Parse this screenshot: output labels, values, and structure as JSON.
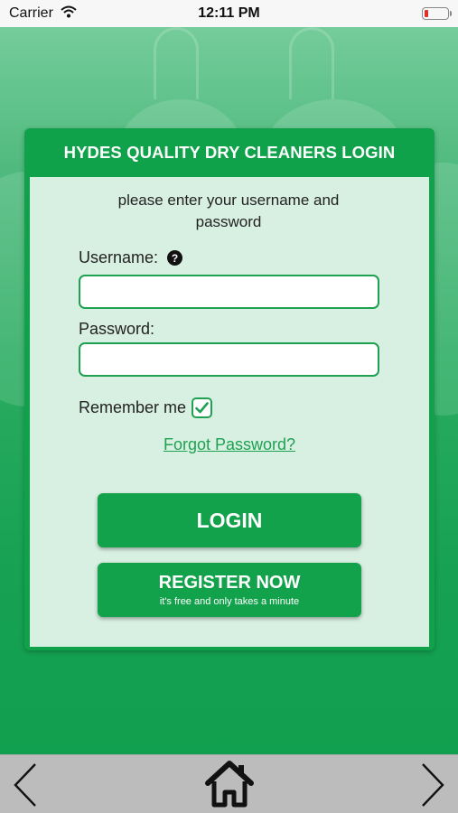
{
  "status_bar": {
    "carrier": "Carrier",
    "time": "12:11 PM"
  },
  "login": {
    "title": "HYDES QUALITY DRY CLEANERS LOGIN",
    "intro": "please enter your username and password",
    "username_label": "Username:",
    "username_value": "",
    "password_label": "Password:",
    "password_value": "",
    "remember_label": "Remember me",
    "remember_checked": true,
    "forgot_link": "Forgot Password?",
    "login_button": "LOGIN",
    "register_button": "REGISTER NOW",
    "register_subtext": "it's free and only takes a minute"
  },
  "nav": {
    "icons": [
      "chevron-left-icon",
      "home-icon",
      "chevron-right-icon"
    ]
  },
  "colors": {
    "brand_green": "#13a24c",
    "accent_green": "#1ea151",
    "nav_bar": "#bcbcbc",
    "battery_low": "#e0302a"
  }
}
